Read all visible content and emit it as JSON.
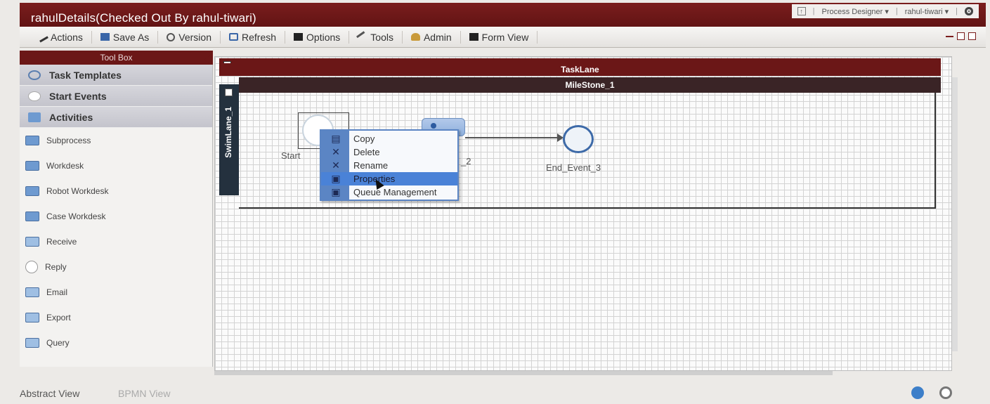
{
  "window": {
    "title": "rahulDetails(Checked Out By rahul-tiwari)",
    "role_menu": "Process Designer ▾",
    "user_menu": "rahul-tiwari ▾"
  },
  "toolbar": {
    "items": [
      {
        "label": "Actions",
        "icon": "wrench-icon"
      },
      {
        "label": "Save As",
        "icon": "save-icon"
      },
      {
        "label": "Version",
        "icon": "version-icon"
      },
      {
        "label": "Refresh",
        "icon": "refresh-icon"
      },
      {
        "label": "Options",
        "icon": "options-icon"
      },
      {
        "label": "Tools",
        "icon": "hammer-icon"
      },
      {
        "label": "Admin",
        "icon": "admin-icon"
      },
      {
        "label": "Form View",
        "icon": "form-icon"
      }
    ]
  },
  "toolbox": {
    "title": "Tool Box",
    "categories": [
      "Task Templates",
      "Start Events",
      "Activities"
    ],
    "tools": [
      "Subprocess",
      "Workdesk",
      "Robot Workdesk",
      "Case Workdesk",
      "Receive",
      "Reply",
      "Email",
      "Export",
      "Query"
    ]
  },
  "canvas": {
    "tasklane": "TaskLane",
    "milestone": "MileStone_1",
    "swimlane": "SwimLane_1",
    "start_label": "Start",
    "activity_label": "_2",
    "end_label": "End_Event_3"
  },
  "context_menu": {
    "items": [
      {
        "label": "Copy",
        "icon": "copy-icon"
      },
      {
        "label": "Delete",
        "icon": "delete-icon"
      },
      {
        "label": "Rename",
        "icon": "rename-icon"
      },
      {
        "label": "Properties",
        "icon": "properties-icon"
      },
      {
        "label": "Queue Management",
        "icon": "queue-icon"
      }
    ],
    "highlighted": "Properties"
  },
  "footer": {
    "tabs": [
      "Abstract View",
      "BPMN View"
    ]
  },
  "colors": {
    "accent": "#6b1717",
    "menu_highlight": "#4a82d7"
  }
}
